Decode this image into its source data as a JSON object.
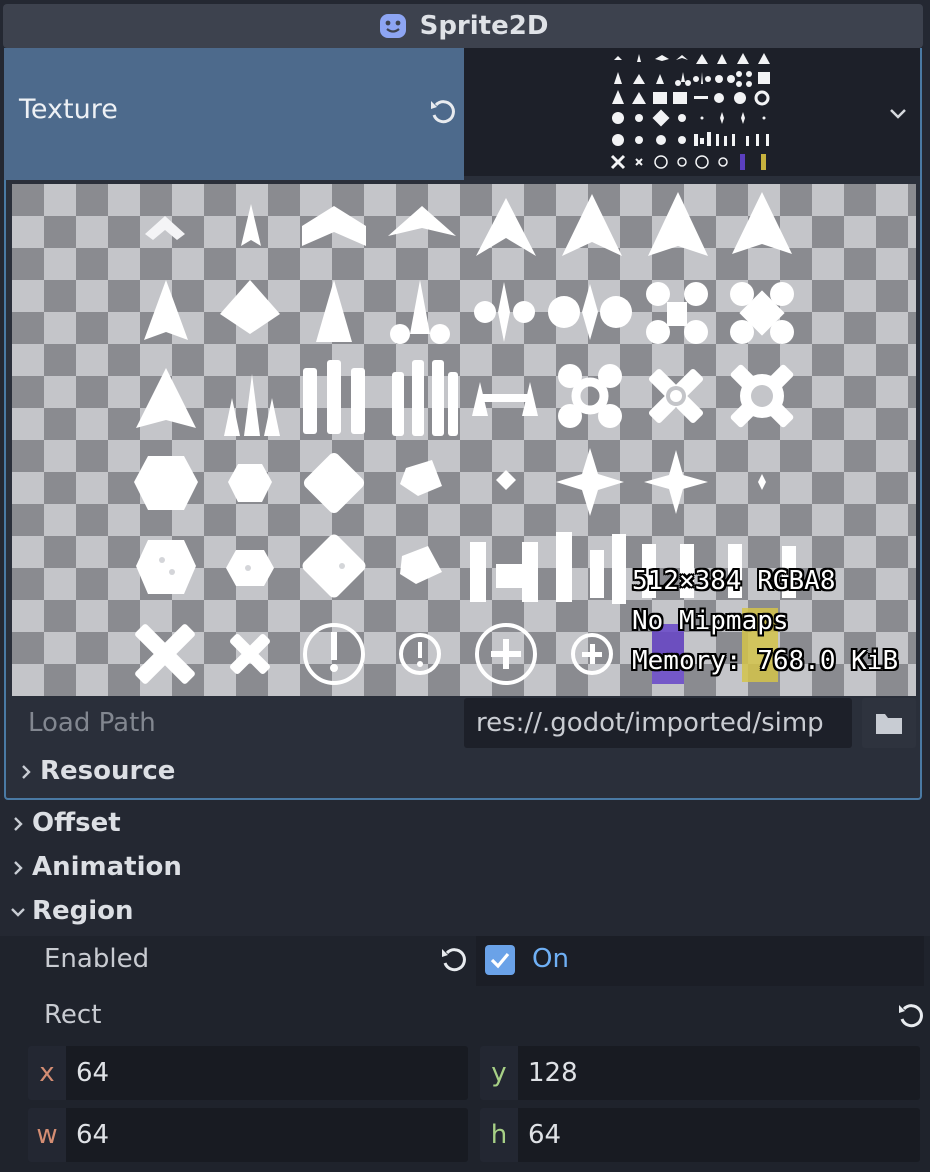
{
  "header": {
    "title": "Sprite2D",
    "icon": "sprite2d-node-icon"
  },
  "texture": {
    "label": "Texture",
    "info": [
      "512×384 RGBA8",
      "No Mipmaps",
      "Memory: 768.0 KiB"
    ],
    "load_path_label": "Load Path",
    "load_path_value": "res://.godot/imported/simp",
    "resource_label": "Resource"
  },
  "sections": {
    "offset": "Offset",
    "animation": "Animation",
    "region": "Region"
  },
  "region": {
    "enabled_label": "Enabled",
    "enabled_value": "On",
    "enabled": true,
    "rect_label": "Rect",
    "rect": {
      "x_label": "x",
      "x": "64",
      "y_label": "y",
      "y": "128",
      "w_label": "w",
      "w": "64",
      "h_label": "h",
      "h": "64"
    }
  },
  "colors": {
    "accent": "#4a7aa4",
    "x_axis": "#d48d73",
    "y_axis": "#a7d086",
    "on_text": "#6fb0f5"
  }
}
